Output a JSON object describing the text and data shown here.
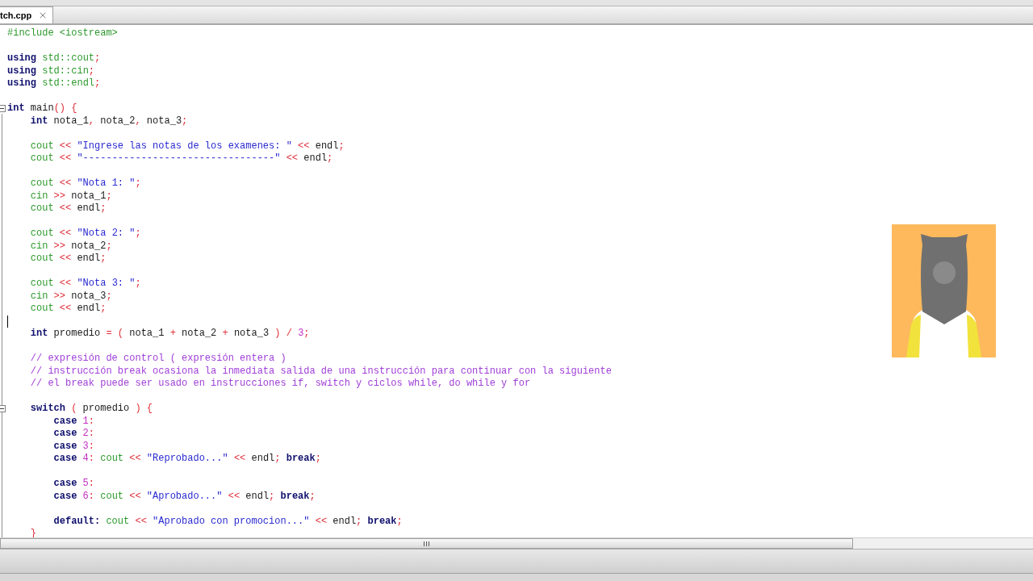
{
  "tab": {
    "label": "tch.cpp",
    "selected": true
  },
  "lines": [
    {
      "kind": "code",
      "fold": false,
      "tokens": [
        {
          "kind": "pre",
          "text": "#include <iostream>"
        }
      ]
    },
    {
      "kind": "blank",
      "fold": false
    },
    {
      "kind": "code",
      "fold": false,
      "tokens": [
        {
          "kind": "kw",
          "text": "using"
        },
        {
          "kind": "lib",
          "text": " std::cout"
        },
        {
          "kind": "op",
          "text": ";"
        }
      ]
    },
    {
      "kind": "code",
      "fold": false,
      "tokens": [
        {
          "kind": "kw",
          "text": "using"
        },
        {
          "kind": "lib",
          "text": " std::cin"
        },
        {
          "kind": "op",
          "text": ";"
        }
      ]
    },
    {
      "kind": "code",
      "fold": false,
      "tokens": [
        {
          "kind": "kw",
          "text": "using"
        },
        {
          "kind": "lib",
          "text": " std::endl"
        },
        {
          "kind": "op",
          "text": ";"
        }
      ]
    },
    {
      "kind": "blank",
      "fold": false
    },
    {
      "kind": "code",
      "fold": true,
      "tokens": [
        {
          "kind": "kw",
          "text": "int"
        },
        {
          "kind": "id",
          "text": " main"
        },
        {
          "kind": "op",
          "text": "() {"
        }
      ]
    },
    {
      "kind": "code",
      "fold": false,
      "tokens": [
        {
          "kind": "kw",
          "text": "    int"
        },
        {
          "kind": "id",
          "text": " nota_1"
        },
        {
          "kind": "op",
          "text": ","
        },
        {
          "kind": "id",
          "text": " nota_2"
        },
        {
          "kind": "op",
          "text": ","
        },
        {
          "kind": "id",
          "text": " nota_3"
        },
        {
          "kind": "op",
          "text": ";"
        }
      ]
    },
    {
      "kind": "blank",
      "fold": false
    },
    {
      "kind": "code",
      "fold": false,
      "tokens": [
        {
          "kind": "lib",
          "text": "    cout"
        },
        {
          "kind": "op",
          "text": " <<"
        },
        {
          "kind": "str",
          "text": " \"Ingrese las notas de los examenes: \""
        },
        {
          "kind": "op",
          "text": " <<"
        },
        {
          "kind": "id",
          "text": " endl"
        },
        {
          "kind": "op",
          "text": ";"
        }
      ]
    },
    {
      "kind": "code",
      "fold": false,
      "tokens": [
        {
          "kind": "lib",
          "text": "    cout"
        },
        {
          "kind": "op",
          "text": " <<"
        },
        {
          "kind": "str",
          "text": " \"---------------------------------\""
        },
        {
          "kind": "op",
          "text": " <<"
        },
        {
          "kind": "id",
          "text": " endl"
        },
        {
          "kind": "op",
          "text": ";"
        }
      ]
    },
    {
      "kind": "blank",
      "fold": false
    },
    {
      "kind": "code",
      "fold": false,
      "tokens": [
        {
          "kind": "lib",
          "text": "    cout"
        },
        {
          "kind": "op",
          "text": " <<"
        },
        {
          "kind": "str",
          "text": " \"Nota 1: \""
        },
        {
          "kind": "op",
          "text": ";"
        }
      ]
    },
    {
      "kind": "code",
      "fold": false,
      "tokens": [
        {
          "kind": "lib",
          "text": "    cin"
        },
        {
          "kind": "op",
          "text": " >>"
        },
        {
          "kind": "id",
          "text": " nota_1"
        },
        {
          "kind": "op",
          "text": ";"
        }
      ]
    },
    {
      "kind": "code",
      "fold": false,
      "tokens": [
        {
          "kind": "lib",
          "text": "    cout"
        },
        {
          "kind": "op",
          "text": " <<"
        },
        {
          "kind": "id",
          "text": " endl"
        },
        {
          "kind": "op",
          "text": ";"
        }
      ]
    },
    {
      "kind": "blank",
      "fold": false
    },
    {
      "kind": "code",
      "fold": false,
      "tokens": [
        {
          "kind": "lib",
          "text": "    cout"
        },
        {
          "kind": "op",
          "text": " <<"
        },
        {
          "kind": "str",
          "text": " \"Nota 2: \""
        },
        {
          "kind": "op",
          "text": ";"
        }
      ]
    },
    {
      "kind": "code",
      "fold": false,
      "tokens": [
        {
          "kind": "lib",
          "text": "    cin"
        },
        {
          "kind": "op",
          "text": " >>"
        },
        {
          "kind": "id",
          "text": " nota_2"
        },
        {
          "kind": "op",
          "text": ";"
        }
      ]
    },
    {
      "kind": "code",
      "fold": false,
      "tokens": [
        {
          "kind": "lib",
          "text": "    cout"
        },
        {
          "kind": "op",
          "text": " <<"
        },
        {
          "kind": "id",
          "text": " endl"
        },
        {
          "kind": "op",
          "text": ";"
        }
      ]
    },
    {
      "kind": "blank",
      "fold": false
    },
    {
      "kind": "code",
      "fold": false,
      "tokens": [
        {
          "kind": "lib",
          "text": "    cout"
        },
        {
          "kind": "op",
          "text": " <<"
        },
        {
          "kind": "str",
          "text": " \"Nota 3: \""
        },
        {
          "kind": "op",
          "text": ";"
        }
      ]
    },
    {
      "kind": "code",
      "fold": false,
      "tokens": [
        {
          "kind": "lib",
          "text": "    cin"
        },
        {
          "kind": "op",
          "text": " >>"
        },
        {
          "kind": "id",
          "text": " nota_3"
        },
        {
          "kind": "op",
          "text": ";"
        }
      ]
    },
    {
      "kind": "code",
      "fold": false,
      "tokens": [
        {
          "kind": "lib",
          "text": "    cout"
        },
        {
          "kind": "op",
          "text": " <<"
        },
        {
          "kind": "id",
          "text": " endl"
        },
        {
          "kind": "op",
          "text": ";"
        }
      ]
    },
    {
      "kind": "caret",
      "fold": false
    },
    {
      "kind": "code",
      "fold": false,
      "tokens": [
        {
          "kind": "kw",
          "text": "    int"
        },
        {
          "kind": "id",
          "text": " promedio"
        },
        {
          "kind": "op",
          "text": " = ("
        },
        {
          "kind": "id",
          "text": " nota_1"
        },
        {
          "kind": "op",
          "text": " +"
        },
        {
          "kind": "id",
          "text": " nota_2"
        },
        {
          "kind": "op",
          "text": " +"
        },
        {
          "kind": "id",
          "text": " nota_3"
        },
        {
          "kind": "op",
          "text": " ) /"
        },
        {
          "kind": "num",
          "text": " 3"
        },
        {
          "kind": "op",
          "text": ";"
        }
      ]
    },
    {
      "kind": "blank",
      "fold": false
    },
    {
      "kind": "code",
      "fold": false,
      "tokens": [
        {
          "kind": "cmt",
          "text": "    // expresión de control ( expresión entera )"
        }
      ]
    },
    {
      "kind": "code",
      "fold": false,
      "tokens": [
        {
          "kind": "cmt",
          "text": "    // instrucción break ocasiona la inmediata salida de una instrucción para continuar con la siguiente"
        }
      ]
    },
    {
      "kind": "code",
      "fold": false,
      "tokens": [
        {
          "kind": "cmt",
          "text": "    // el break puede ser usado en instrucciones if, switch y ciclos while, do while y for"
        }
      ]
    },
    {
      "kind": "blank",
      "fold": false
    },
    {
      "kind": "code",
      "fold": true,
      "tokens": [
        {
          "kind": "kw",
          "text": "    switch"
        },
        {
          "kind": "op",
          "text": " ("
        },
        {
          "kind": "id",
          "text": " promedio"
        },
        {
          "kind": "op",
          "text": " ) {"
        }
      ]
    },
    {
      "kind": "code",
      "fold": false,
      "tokens": [
        {
          "kind": "kw",
          "text": "        case"
        },
        {
          "kind": "num",
          "text": " 1"
        },
        {
          "kind": "op",
          "text": ":"
        }
      ]
    },
    {
      "kind": "code",
      "fold": false,
      "tokens": [
        {
          "kind": "kw",
          "text": "        case"
        },
        {
          "kind": "num",
          "text": " 2"
        },
        {
          "kind": "op",
          "text": ":"
        }
      ]
    },
    {
      "kind": "code",
      "fold": false,
      "tokens": [
        {
          "kind": "kw",
          "text": "        case"
        },
        {
          "kind": "num",
          "text": " 3"
        },
        {
          "kind": "op",
          "text": ":"
        }
      ]
    },
    {
      "kind": "code",
      "fold": false,
      "tokens": [
        {
          "kind": "kw",
          "text": "        case"
        },
        {
          "kind": "num",
          "text": " 4"
        },
        {
          "kind": "op",
          "text": ":"
        },
        {
          "kind": "lib",
          "text": " cout"
        },
        {
          "kind": "op",
          "text": " <<"
        },
        {
          "kind": "str",
          "text": " \"Reprobado...\""
        },
        {
          "kind": "op",
          "text": " <<"
        },
        {
          "kind": "id",
          "text": " endl"
        },
        {
          "kind": "op",
          "text": ";"
        },
        {
          "kind": "kw",
          "text": " break"
        },
        {
          "kind": "op",
          "text": ";"
        }
      ]
    },
    {
      "kind": "blank",
      "fold": false
    },
    {
      "kind": "code",
      "fold": false,
      "tokens": [
        {
          "kind": "kw",
          "text": "        case"
        },
        {
          "kind": "num",
          "text": " 5"
        },
        {
          "kind": "op",
          "text": ":"
        }
      ]
    },
    {
      "kind": "code",
      "fold": false,
      "tokens": [
        {
          "kind": "kw",
          "text": "        case"
        },
        {
          "kind": "num",
          "text": " 6"
        },
        {
          "kind": "op",
          "text": ":"
        },
        {
          "kind": "lib",
          "text": " cout"
        },
        {
          "kind": "op",
          "text": " <<"
        },
        {
          "kind": "str",
          "text": " \"Aprobado...\""
        },
        {
          "kind": "op",
          "text": " <<"
        },
        {
          "kind": "id",
          "text": " endl"
        },
        {
          "kind": "op",
          "text": ";"
        },
        {
          "kind": "kw",
          "text": " break"
        },
        {
          "kind": "op",
          "text": ";"
        }
      ]
    },
    {
      "kind": "blank",
      "fold": false
    },
    {
      "kind": "code",
      "fold": false,
      "tokens": [
        {
          "kind": "kw",
          "text": "        default:"
        },
        {
          "kind": "lib",
          "text": " cout"
        },
        {
          "kind": "op",
          "text": " <<"
        },
        {
          "kind": "str",
          "text": " \"Aprobado con promocion...\""
        },
        {
          "kind": "op",
          "text": " <<"
        },
        {
          "kind": "id",
          "text": " endl"
        },
        {
          "kind": "op",
          "text": ";"
        },
        {
          "kind": "kw",
          "text": " break"
        },
        {
          "kind": "op",
          "text": ";"
        }
      ]
    },
    {
      "kind": "code",
      "fold": false,
      "tokens": [
        {
          "kind": "op",
          "text": "    }"
        }
      ]
    }
  ]
}
